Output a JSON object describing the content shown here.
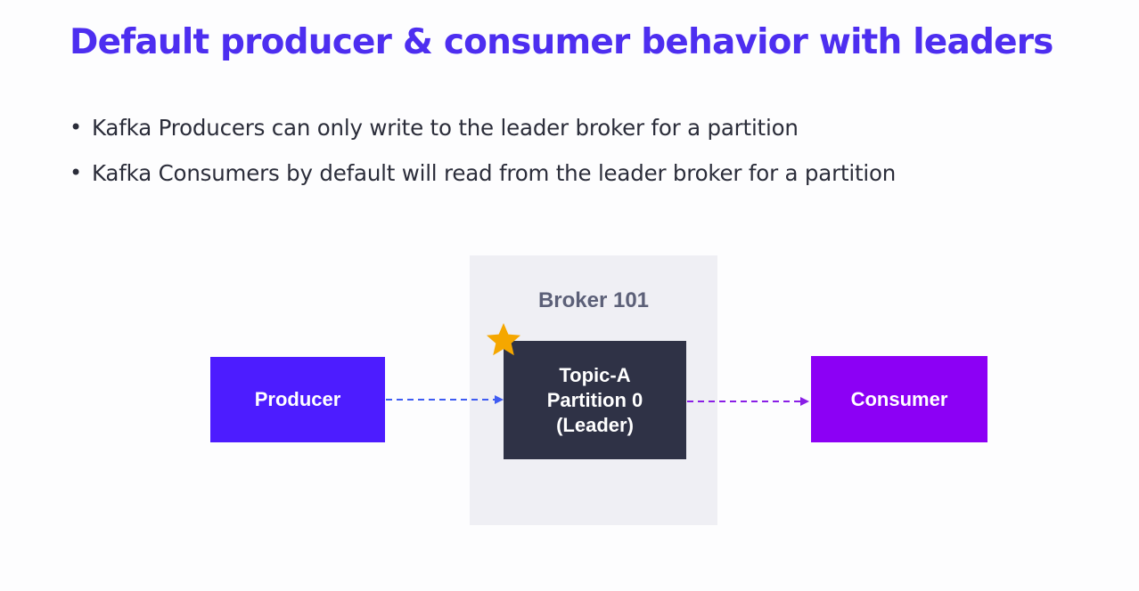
{
  "slide": {
    "title": "Default producer & consumer behavior with leaders",
    "bullets": [
      "Kafka Producers can only write to the leader broker for a partition",
      "Kafka Consumers by default will read from the leader broker for a partition"
    ]
  },
  "diagram": {
    "broker": {
      "label": "Broker 101"
    },
    "producer": {
      "label": "Producer"
    },
    "consumer": {
      "label": "Consumer"
    },
    "partition": {
      "lines": [
        "Topic-A",
        "Partition 0",
        "(Leader)"
      ]
    },
    "leader_marker_icon": "star-icon"
  },
  "colors": {
    "title": "#4d2ef0",
    "producer": "#4d1cff",
    "consumer": "#8c00f5",
    "partition": "#2f3246",
    "star": "#f5a700",
    "arrow_producer": "#3f5cf2",
    "arrow_consumer": "#8a1ee6"
  }
}
